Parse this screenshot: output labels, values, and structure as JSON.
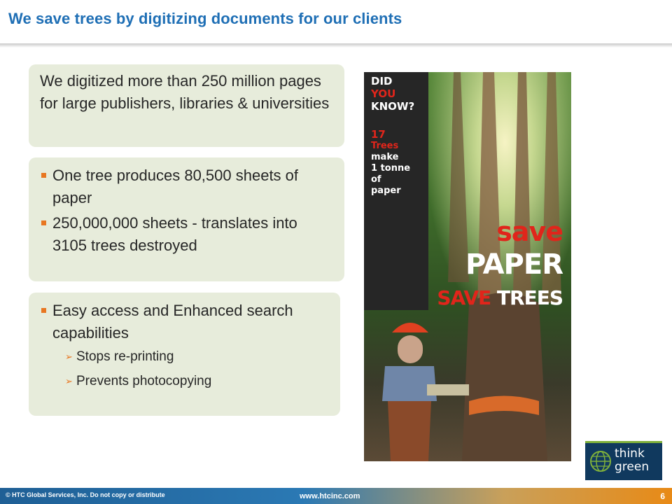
{
  "title": "We save trees by digitizing documents for our clients",
  "box1": {
    "text": "We digitized more than 250 million pages for large publishers, libraries & universities"
  },
  "box2": {
    "bullets": [
      "One tree produces 80,500 sheets of paper",
      "250,000,000 sheets - translates into 3105 trees destroyed"
    ]
  },
  "box3": {
    "bullet": "Easy access and Enhanced search capabilities",
    "sub_bullets": [
      "Stops re-printing",
      "Prevents photocopying"
    ]
  },
  "poster": {
    "did": "DID",
    "you": "YOU",
    "know": "KNOW?",
    "num": "17",
    "trees": "Trees",
    "make": "make",
    "tonne": "1 tonne",
    "of": "of",
    "paper": "paper",
    "save": "save",
    "paper_big": "PAPER",
    "save_word": "SAVE",
    "trees_word": "TREES"
  },
  "logo": {
    "line1": "think",
    "line2": "green"
  },
  "footer": {
    "copyright": "© HTC Global Services, Inc. Do not copy or distribute",
    "url": "www.htcinc.com",
    "page": "6"
  },
  "colors": {
    "title": "#1f6fb5",
    "box_bg": "#e7ecdb",
    "bullet": "#e87722",
    "poster_red": "#e0251b",
    "logo_bg": "#10395e"
  }
}
